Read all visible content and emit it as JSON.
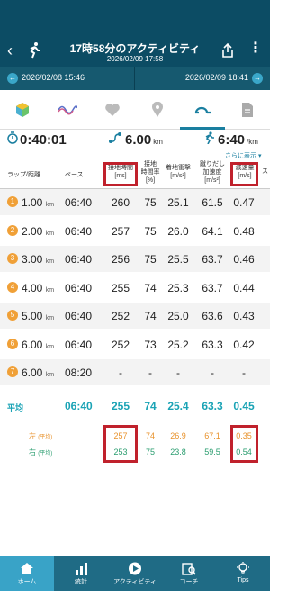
{
  "header": {
    "title": "17時58分のアクティビティ",
    "subtitle": "2026/02/09 17:58",
    "back_icon": "back-arrow-icon",
    "share_icon": "share-icon",
    "more_icon": "more-vertical-icon"
  },
  "date_nav": {
    "prev": "2026/02/08 15:46",
    "next": "2026/02/09 18:41"
  },
  "tabs": [
    "summary-cube",
    "wave",
    "heart",
    "map-pin",
    "laps",
    "document"
  ],
  "summary": {
    "time": "0:40:01",
    "distance": "6.00",
    "distance_unit": "km",
    "pace": "6:40",
    "pace_unit": "/km"
  },
  "more_label": "さらに表示",
  "table": {
    "headers": {
      "lap": "ラップ/距離",
      "pace": "ペース",
      "contact_time": "接地時間",
      "contact_time_unit": "[ms]",
      "contact_ratio_1": "接地",
      "contact_ratio_2": "時間率",
      "contact_ratio_unit": "[%]",
      "impact": "着地衝撃",
      "impact_unit": "[m/s²]",
      "kick_1": "蹴りだし",
      "kick_2": "加速度",
      "kick_unit": "[m/s²]",
      "decel": "減速量",
      "decel_unit": "[m/s]",
      "extra": "ス"
    },
    "rows": [
      {
        "n": "1",
        "dist": "1.00",
        "unit": "km",
        "pace": "06:40",
        "ct": "260",
        "cr": "75",
        "imp": "25.1",
        "kick": "61.5",
        "dec": "0.47"
      },
      {
        "n": "2",
        "dist": "2.00",
        "unit": "km",
        "pace": "06:40",
        "ct": "257",
        "cr": "75",
        "imp": "26.0",
        "kick": "64.1",
        "dec": "0.48"
      },
      {
        "n": "3",
        "dist": "3.00",
        "unit": "km",
        "pace": "06:40",
        "ct": "256",
        "cr": "75",
        "imp": "25.5",
        "kick": "63.7",
        "dec": "0.46"
      },
      {
        "n": "4",
        "dist": "4.00",
        "unit": "km",
        "pace": "06:40",
        "ct": "255",
        "cr": "74",
        "imp": "25.3",
        "kick": "63.7",
        "dec": "0.44"
      },
      {
        "n": "5",
        "dist": "5.00",
        "unit": "km",
        "pace": "06:40",
        "ct": "252",
        "cr": "74",
        "imp": "25.0",
        "kick": "63.6",
        "dec": "0.43"
      },
      {
        "n": "6",
        "dist": "6.00",
        "unit": "km",
        "pace": "06:40",
        "ct": "252",
        "cr": "73",
        "imp": "25.2",
        "kick": "63.3",
        "dec": "0.42"
      },
      {
        "n": "7",
        "dist": "6.00",
        "unit": "km",
        "pace": "08:20",
        "ct": "-",
        "cr": "-",
        "imp": "-",
        "kick": "-",
        "dec": "-"
      }
    ],
    "average": {
      "label": "平均",
      "pace": "06:40",
      "ct": "255",
      "cr": "74",
      "imp": "25.4",
      "kick": "63.3",
      "dec": "0.45"
    },
    "left": {
      "label": "左",
      "sub": "(平均)",
      "ct": "257",
      "cr": "74",
      "imp": "26.9",
      "kick": "67.1",
      "dec": "0.35"
    },
    "right": {
      "label": "右",
      "sub": "(平均)",
      "ct": "253",
      "cr": "75",
      "imp": "23.8",
      "kick": "59.5",
      "dec": "0.54"
    }
  },
  "nav": {
    "home": "ホーム",
    "stats": "統計",
    "activity": "アクティビティ",
    "coach": "コーチ",
    "tips": "Tips"
  },
  "colors": {
    "header": "#0c4c64",
    "accent": "#1a7fa0",
    "average": "#1aa3b5",
    "left": "#e8922c",
    "right": "#2a9d6f",
    "highlight": "#c0212c",
    "badge": "#f0a037"
  }
}
